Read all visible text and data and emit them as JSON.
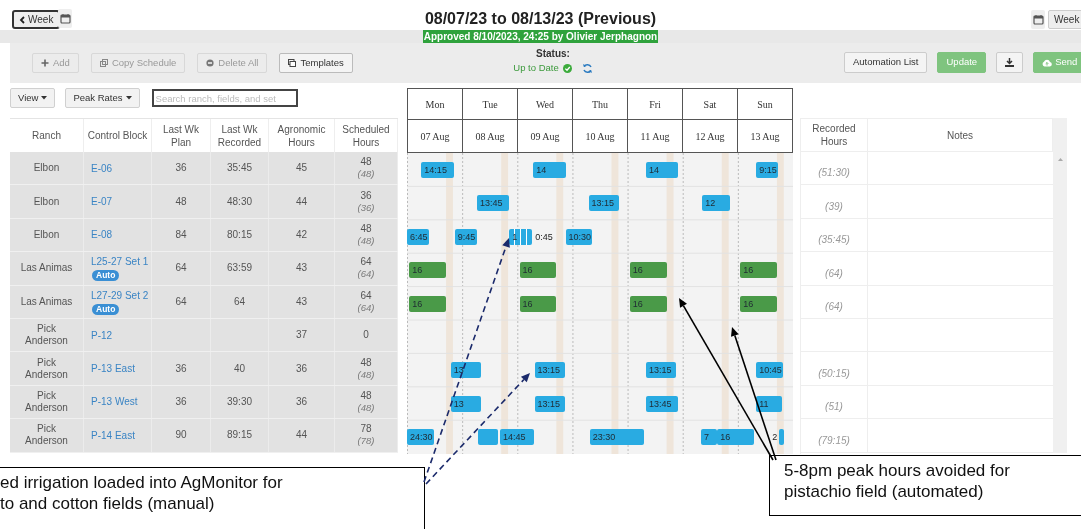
{
  "header": {
    "back_button": "Week",
    "title": "08/07/23 to 08/13/23 (Previous)",
    "approval": "Approved 8/10/2023, 24:25 by Olivier Jerphagnon",
    "week_button": "Week"
  },
  "toolbar": {
    "left_buttons": [
      {
        "label": "Add",
        "disabled": true
      },
      {
        "label": "Copy Schedule",
        "disabled": true
      },
      {
        "label": "Delete All",
        "disabled": true
      },
      {
        "label": "Templates",
        "disabled": false
      }
    ],
    "status_label": "Status:",
    "status_value": "Up to Date",
    "right_buttons": [
      {
        "label": "Automation List",
        "kind": "plain"
      },
      {
        "label": "Update",
        "kind": "green"
      },
      {
        "kind": "download"
      },
      {
        "label": "Send",
        "kind": "green"
      }
    ]
  },
  "filters": {
    "view": "View",
    "peak_rates": "Peak Rates",
    "search_placeholder": "Search ranch, fields, and set"
  },
  "days": [
    {
      "day": "Mon",
      "date": "07 Aug"
    },
    {
      "day": "Tue",
      "date": "08 Aug"
    },
    {
      "day": "Wed",
      "date": "09 Aug"
    },
    {
      "day": "Thu",
      "date": "10 Aug"
    },
    {
      "day": "Fri",
      "date": "11 Aug"
    },
    {
      "day": "Sat",
      "date": "12 Aug"
    },
    {
      "day": "Sun",
      "date": "13 Aug"
    }
  ],
  "table": {
    "columns": [
      "Ranch",
      "Control Block",
      "Last Wk Plan",
      "Last Wk Recorded",
      "Agronomic Hours",
      "Scheduled Hours"
    ],
    "recorded_column": "Recorded Hours",
    "notes_column": "Notes",
    "rows": [
      {
        "ranch": "Elbon",
        "block": "E-06",
        "auto": false,
        "last_plan": "36",
        "last_recorded": "35:45",
        "agronomic": "45",
        "scheduled": "48",
        "scheduled_note": "(48)",
        "recorded": "(51:30)",
        "blocks": [
          {
            "label": "14:15",
            "color": "#29abe2",
            "kind": "plain"
          },
          {
            "label": "14",
            "color": "#29abe2",
            "kind": "plain"
          },
          {
            "label": "14",
            "color": "#29abe2",
            "kind": "plain"
          },
          {
            "label": "9:15",
            "color": "#29abe2",
            "kind": "plain"
          }
        ]
      },
      {
        "ranch": "Elbon",
        "block": "E-07",
        "auto": false,
        "last_plan": "48",
        "last_recorded": "48:30",
        "agronomic": "44",
        "scheduled": "36",
        "scheduled_note": "(36)",
        "recorded": "(39)",
        "blocks": [
          {
            "label": "13:45",
            "color": "#29abe2",
            "kind": "plain"
          },
          {
            "label": "13:15",
            "color": "#29abe2",
            "kind": "plain"
          },
          {
            "label": "12",
            "color": "#29abe2",
            "kind": "plain"
          }
        ]
      },
      {
        "ranch": "Elbon",
        "block": "E-08",
        "auto": false,
        "last_plan": "84",
        "last_recorded": "80:15",
        "agronomic": "42",
        "scheduled": "48",
        "scheduled_note": "(48)",
        "recorded": "(35:45)",
        "blocks": [
          {
            "label": "6:45",
            "color": "#29abe2",
            "kind": "plain"
          },
          {
            "label": "9:45",
            "color": "#29abe2",
            "kind": "plain"
          },
          {
            "label": "1",
            "trailing": "0:45",
            "color": "#29abe2",
            "kind": "split"
          },
          {
            "label": "10:30",
            "color": "#29abe2",
            "kind": "plain"
          }
        ]
      },
      {
        "ranch": "Las Animas",
        "block": "L25-27 Set 1",
        "auto": true,
        "auto_label": "Auto",
        "last_plan": "64",
        "last_recorded": "63:59",
        "agronomic": "43",
        "scheduled": "64",
        "scheduled_note": "(64)",
        "recorded": "(64)",
        "blocks": [
          {
            "label": "16",
            "color": "#4a9a48",
            "kind": "plain"
          },
          {
            "label": "16",
            "color": "#4a9a48",
            "kind": "plain"
          },
          {
            "label": "16",
            "color": "#4a9a48",
            "kind": "plain"
          },
          {
            "label": "16",
            "color": "#4a9a48",
            "kind": "plain"
          }
        ]
      },
      {
        "ranch": "Las Animas",
        "block": "L27-29 Set 2",
        "auto": true,
        "auto_label": "Auto",
        "last_plan": "64",
        "last_recorded": "64",
        "agronomic": "43",
        "scheduled": "64",
        "scheduled_note": "(64)",
        "recorded": "(64)",
        "blocks": [
          {
            "label": "16",
            "color": "#4a9a48",
            "kind": "plain"
          },
          {
            "label": "16",
            "color": "#4a9a48",
            "kind": "plain"
          },
          {
            "label": "16",
            "color": "#4a9a48",
            "kind": "plain"
          },
          {
            "label": "16",
            "color": "#4a9a48",
            "kind": "plain"
          }
        ]
      },
      {
        "ranch": "Pick Anderson",
        "block": "P-12",
        "auto": false,
        "agronomic": "37",
        "scheduled": "0"
      },
      {
        "ranch": "Pick Anderson",
        "block": "P-13 East",
        "auto": false,
        "last_plan": "36",
        "last_recorded": "40",
        "agronomic": "36",
        "scheduled": "48",
        "scheduled_note": "(48)",
        "recorded": "(50:15)",
        "blocks": [
          {
            "label": "13",
            "color": "#29abe2",
            "kind": "plain"
          },
          {
            "label": "13:15",
            "color": "#29abe2",
            "kind": "plain"
          },
          {
            "label": "13:15",
            "color": "#29abe2",
            "kind": "plain"
          },
          {
            "label": "10:45",
            "color": "#29abe2",
            "kind": "plain"
          }
        ]
      },
      {
        "ranch": "Pick Anderson",
        "block": "P-13 West",
        "auto": false,
        "last_plan": "36",
        "last_recorded": "39:30",
        "agronomic": "36",
        "scheduled": "48",
        "scheduled_note": "(48)",
        "recorded": "(51)",
        "blocks": [
          {
            "label": "13",
            "color": "#29abe2",
            "kind": "plain"
          },
          {
            "label": "13:15",
            "color": "#29abe2",
            "kind": "plain"
          },
          {
            "label": "13:45",
            "color": "#29abe2",
            "kind": "plain"
          },
          {
            "label": "11",
            "color": "#29abe2",
            "kind": "plain"
          }
        ]
      },
      {
        "ranch": "Pick Anderson",
        "block": "P-14 East",
        "auto": false,
        "last_plan": "90",
        "last_recorded": "89:15",
        "agronomic": "44",
        "scheduled": "78",
        "scheduled_note": "(78)",
        "recorded": "(79:15)",
        "blocks": [
          {
            "label": "24:30",
            "color": "#29abe2",
            "kind": "plain"
          },
          {
            "color": "#29abe2",
            "kind": "plain"
          },
          {
            "label": "14:45",
            "color": "#29abe2",
            "kind": "plain"
          },
          {
            "label": "23:30",
            "color": "#29abe2",
            "kind": "plain"
          },
          {
            "label": "7",
            "color": "#29abe2",
            "kind": "plain"
          },
          {
            "label": "16",
            "color": "#29abe2",
            "kind": "plain"
          },
          {
            "label": "2",
            "color": "#29abe2",
            "kind": "thin"
          }
        ]
      }
    ]
  },
  "annotations": [
    {
      "lines": [
        "ed irrigation loaded into AgMonitor for",
        "to and cotton fields (manual)"
      ],
      "kind": "dashed"
    },
    {
      "lines": [
        "5-8pm peak hours avoided for",
        "pistachio field (automated)"
      ],
      "kind": "solid"
    }
  ]
}
